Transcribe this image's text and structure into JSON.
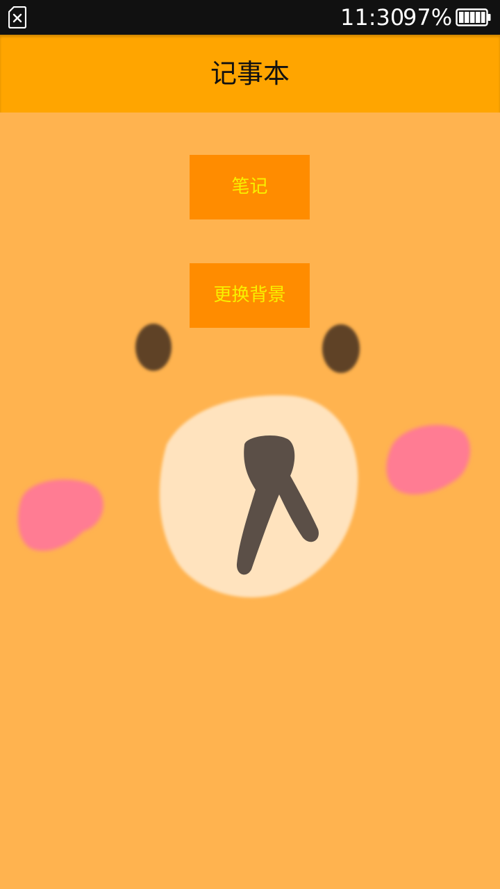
{
  "status_bar": {
    "time": "11:30",
    "battery_percent": "97%",
    "icons": [
      "no-sim-icon",
      "battery-icon"
    ]
  },
  "app_bar": {
    "title": "记事本",
    "background_color": "#FFA500"
  },
  "menu": {
    "notes_label": "笔记",
    "change_background_label": "更换背景",
    "button_color": "#FF8C00",
    "label_color": "#F8F000"
  },
  "background": {
    "color": "#FFB34F",
    "description_icon": "bear-face-illustration"
  }
}
